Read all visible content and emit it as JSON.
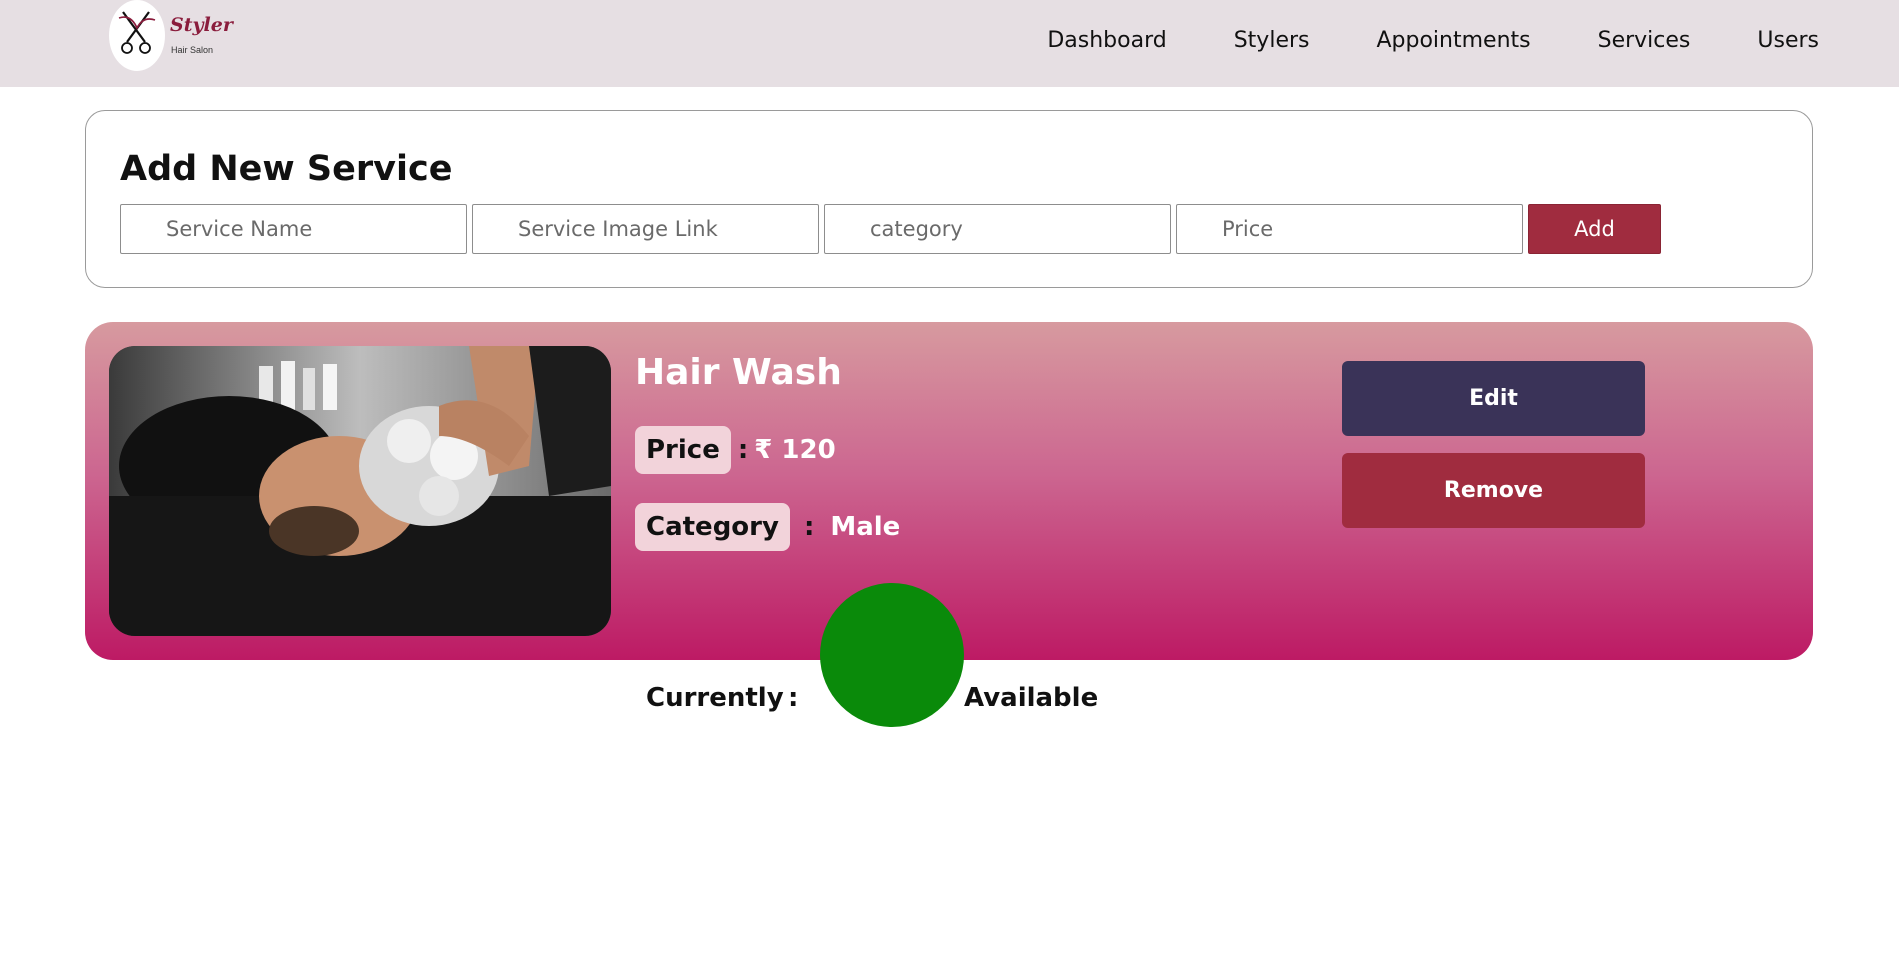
{
  "brand": {
    "name": "Styler",
    "subtitle": "Hair Salon",
    "accent_color": "#8a1c3c",
    "logo_icon": "scissors-icon"
  },
  "nav": {
    "items": [
      {
        "label": "Dashboard"
      },
      {
        "label": "Stylers"
      },
      {
        "label": "Appointments"
      },
      {
        "label": "Services"
      },
      {
        "label": "Users"
      }
    ]
  },
  "add_service": {
    "title": "Add New Service",
    "fields": {
      "name": {
        "placeholder": "Service Name",
        "value": ""
      },
      "image_link": {
        "placeholder": "Service Image Link",
        "value": ""
      },
      "category": {
        "placeholder": "category",
        "value": ""
      },
      "price": {
        "placeholder": "Price",
        "value": ""
      }
    },
    "add_label": "Add",
    "button_color": "#a02c3f"
  },
  "service": {
    "title": "Hair Wash",
    "price_label": "Price",
    "price_value": "₹ 120",
    "category_label": "Category",
    "category_value": "Male",
    "sep": ":",
    "edit_label": "Edit",
    "remove_label": "Remove",
    "edit_color": "#3a3358",
    "remove_color": "#a02c3f"
  },
  "status": {
    "label": "Currently",
    "sep": ":",
    "value": "Available",
    "indicator_color": "#0a8a0a"
  }
}
